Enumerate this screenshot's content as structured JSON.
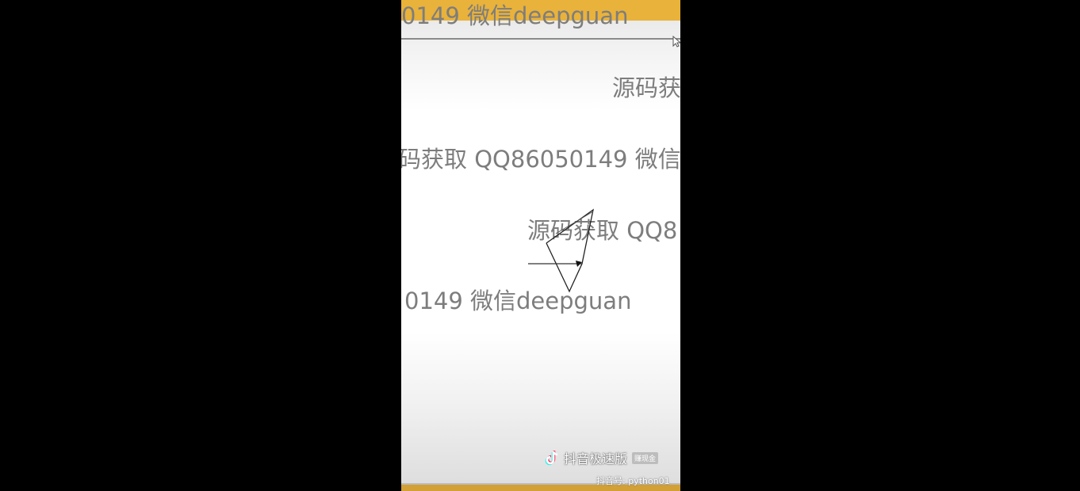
{
  "watermarks": [
    "0149 微信deepguan",
    "源码获",
    "码获取 QQ86050149 微信",
    "源码获取 QQ8",
    "0149 微信deepguan"
  ],
  "brand": {
    "app_name": "抖音极速版",
    "badge": "赚现金",
    "account": "抖音号: python01"
  },
  "colors": {
    "top_strip": "#e9b23a",
    "watermark_text": "#7d7d7d",
    "backdrop": "#000000"
  }
}
